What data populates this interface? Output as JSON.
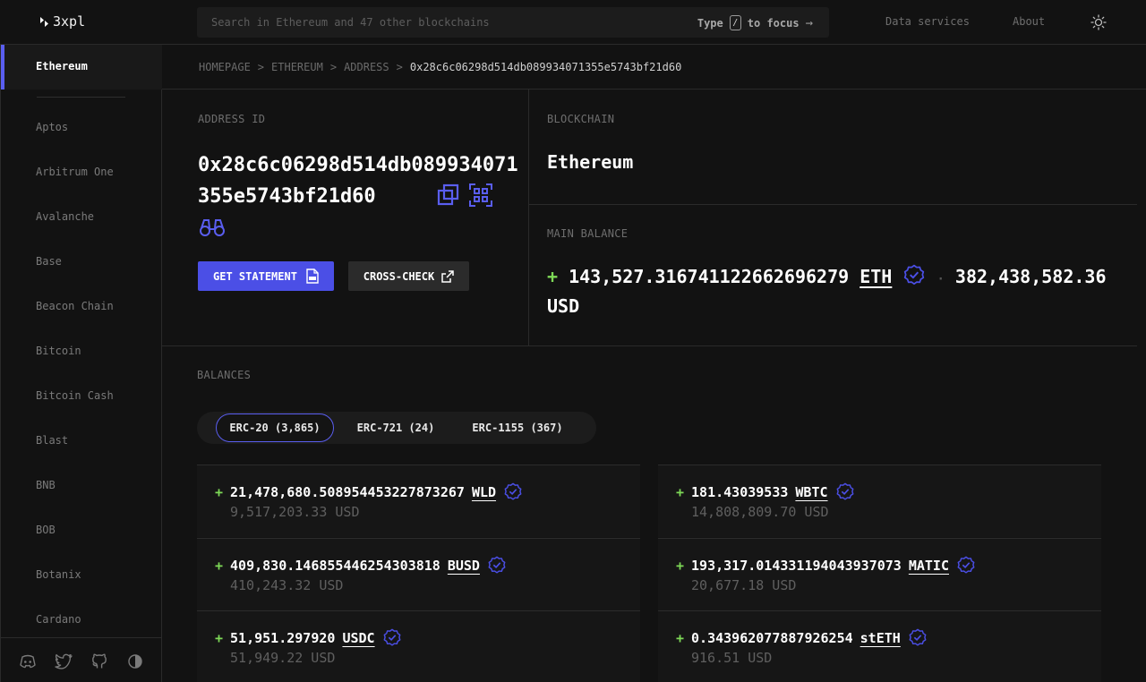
{
  "app": {
    "logo_text": "3xpl"
  },
  "search": {
    "placeholder": "Search in Ethereum and 47 other blockchains",
    "hint_prefix": "Type",
    "hint_key": "/",
    "hint_suffix": "to focus"
  },
  "nav": {
    "data_services": "Data services",
    "about": "About"
  },
  "sidebar": {
    "active": "Ethereum",
    "items": [
      "Aptos",
      "Arbitrum One",
      "Avalanche",
      "Base",
      "Beacon Chain",
      "Bitcoin",
      "Bitcoin Cash",
      "Blast",
      "BNB",
      "BOB",
      "Botanix",
      "Cardano"
    ]
  },
  "breadcrumb": {
    "home": "HOMEPAGE",
    "chain": "ETHEREUM",
    "section": "ADDRESS",
    "current": "0x28c6c06298d514db089934071355e5743bf21d60",
    "sep": ">"
  },
  "address": {
    "label": "ADDRESS ID",
    "value": "0x28c6c06298d514db089934071355e5743bf21d60",
    "statement_button": "GET STATEMENT",
    "crosscheck_button": "CROSS-CHECK"
  },
  "blockchain": {
    "label": "BLOCKCHAIN",
    "name": "Ethereum"
  },
  "main_balance": {
    "label": "MAIN BALANCE",
    "sign": "+",
    "amount": "143,527.316741122662696279",
    "symbol": "ETH",
    "usd": "382,438,582.36",
    "usd_unit": "USD"
  },
  "balances": {
    "label": "BALANCES",
    "tabs": [
      "ERC-20 (3,865)",
      "ERC-721 (24)",
      "ERC-1155 (367)"
    ],
    "active_tab": 0,
    "tokens": [
      {
        "amount": "21,478,680.508954453227873267",
        "symbol": "WLD",
        "usd": "9,517,203.33 USD"
      },
      {
        "amount": "181.43039533",
        "symbol": "WBTC",
        "usd": "14,808,809.70 USD"
      },
      {
        "amount": "409,830.146855446254303818",
        "symbol": "BUSD",
        "usd": "410,243.32 USD"
      },
      {
        "amount": "193,317.014331194043937073",
        "symbol": "MATIC",
        "usd": "20,677.18 USD"
      },
      {
        "amount": "51,951.297920",
        "symbol": "USDC",
        "usd": "51,949.22 USD"
      },
      {
        "amount": "0.343962077887926254",
        "symbol": "stETH",
        "usd": "916.51 USD"
      }
    ]
  },
  "colors": {
    "accent": "#4b4fe6",
    "positive": "#7ed957",
    "background": "#121212"
  }
}
